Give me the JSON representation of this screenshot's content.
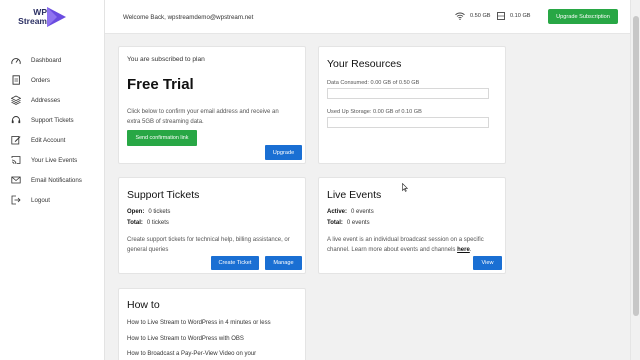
{
  "brand": {
    "line1": "WP",
    "line2": "Stream",
    "accent": "#6a4ce0"
  },
  "sidebar": {
    "items": [
      {
        "label": "Dashboard",
        "icon": "dashboard-icon"
      },
      {
        "label": "Orders",
        "icon": "document-icon"
      },
      {
        "label": "Addresses",
        "icon": "layers-icon"
      },
      {
        "label": "Support Tickets",
        "icon": "support-icon"
      },
      {
        "label": "Edit Account",
        "icon": "edit-icon"
      },
      {
        "label": "Your Live Events",
        "icon": "cast-icon"
      },
      {
        "label": "Email Notifications",
        "icon": "envelope-icon"
      },
      {
        "label": "Logout",
        "icon": "logout-icon"
      }
    ]
  },
  "header": {
    "welcome": "Welcome Back, wpstreamdemo@wpstream.net",
    "data_usage": "0.50 GB",
    "storage_usage": "0.10 GB",
    "upgrade_label": "Upgrade Subscription"
  },
  "plan": {
    "subscribed_text": "You are subscribed to plan",
    "name": "Free Trial",
    "description": "Click below to confirm your email address and receive an extra 5GB of streaming data.",
    "confirm_label": "Send confirmation link",
    "upgrade_label": "Upgrade"
  },
  "resources": {
    "title": "Your Resources",
    "data_label": "Data Consumed: 0.00 GB of 0.50 GB",
    "data_fraction": 0,
    "storage_label": "Used Up Storage: 0.00 GB of 0.10 GB",
    "storage_fraction": 0
  },
  "tickets": {
    "title": "Support Tickets",
    "open_label": "Open:",
    "open_value": "0 tickets",
    "total_label": "Total:",
    "total_value": "0 tickets",
    "description": "Create support tickets for technical help, billing assistance, or general queries",
    "create_label": "Create Ticket",
    "manage_label": "Manage"
  },
  "events": {
    "title": "Live Events",
    "active_label": "Active:",
    "active_value": "0 events",
    "total_label": "Total:",
    "total_value": "0 events",
    "description": "A live event is an individual broadcast session on a specific channel. Learn more about events and channels",
    "link_text": "here",
    "link_suffix": ".",
    "view_label": "View"
  },
  "howto": {
    "title": "How to",
    "links": [
      "How to Live Stream to WordPress in 4 minutes or less",
      "How to Live Stream to WordPress with OBS",
      "How to Broadcast a Pay-Per-View Video on your"
    ]
  },
  "colors": {
    "green": "#28a745",
    "blue": "#1a6fd3",
    "brand_dark": "#2b2f63"
  }
}
